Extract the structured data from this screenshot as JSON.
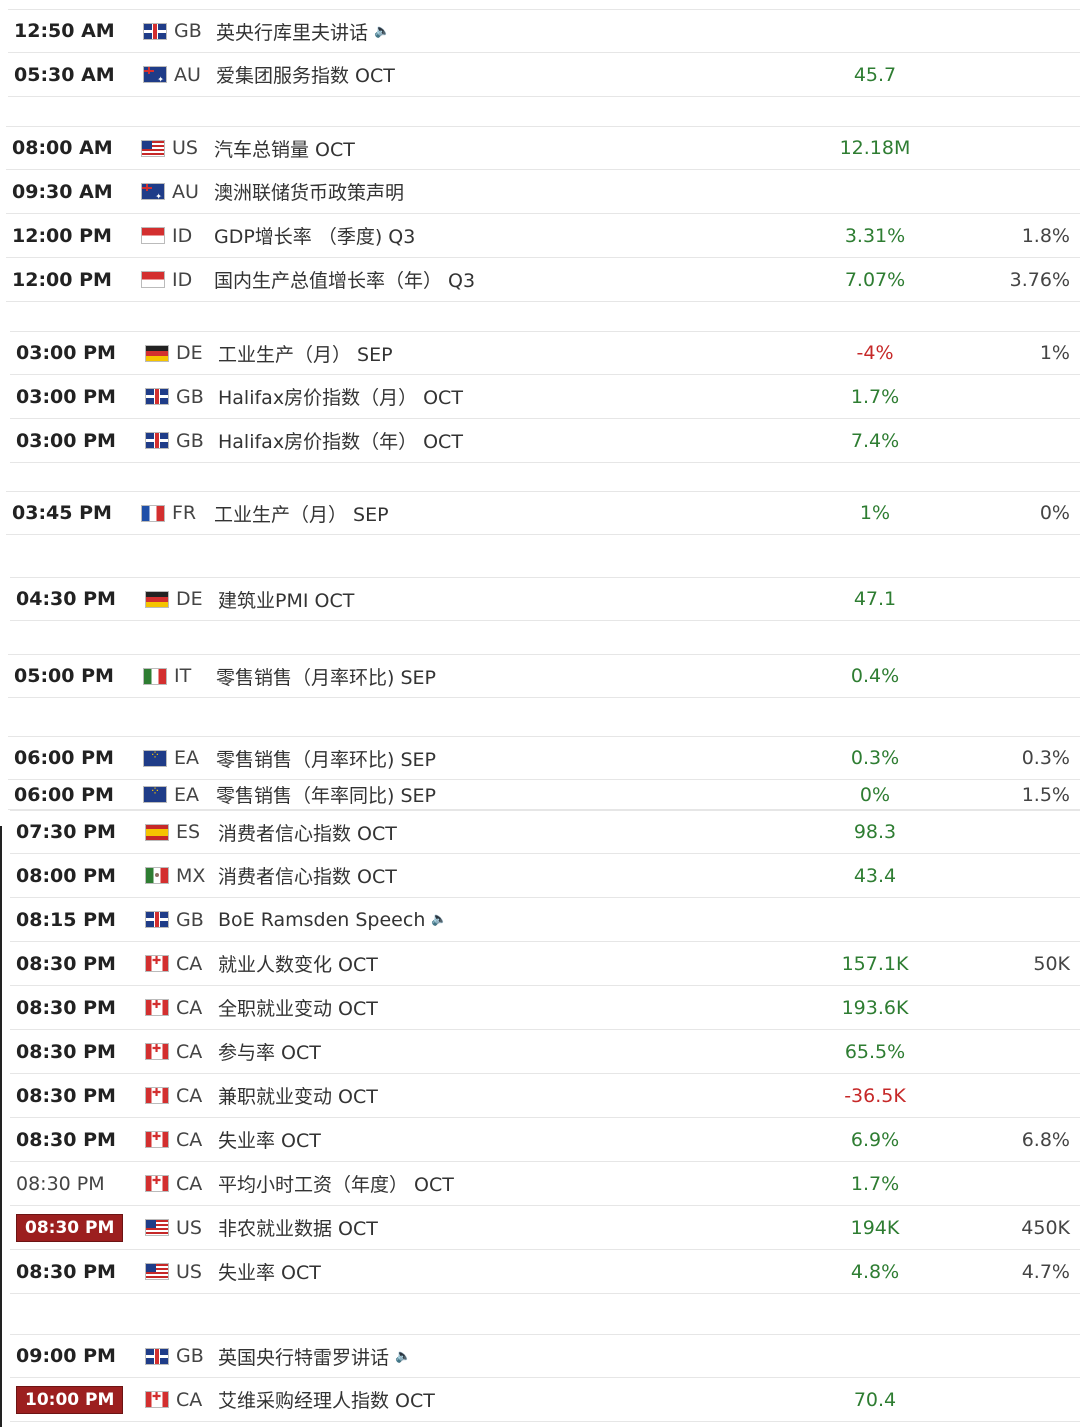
{
  "speaker_icon": "speaker-icon",
  "rows": [
    {
      "time": "12:50 AM",
      "country": "GB",
      "flag": "gb",
      "event": "英央行库里夫讲话",
      "speaker": true,
      "actual": "",
      "forecast": ""
    },
    {
      "time": "05:30 AM",
      "country": "AU",
      "flag": "au",
      "event": "爱集团服务指数 OCT",
      "actual": "45.7",
      "forecast": ""
    },
    {
      "time": "08:00 AM",
      "country": "US",
      "flag": "us",
      "event": "汽车总销量 OCT",
      "actual": "12.18M",
      "forecast": ""
    },
    {
      "time": "09:30 AM",
      "country": "AU",
      "flag": "au",
      "event": "澳洲联储货币政策声明",
      "actual": "",
      "forecast": ""
    },
    {
      "time": "12:00 PM",
      "country": "ID",
      "flag": "id",
      "event": "GDP增长率 （季度) Q3",
      "actual": "3.31%",
      "forecast": "1.8%"
    },
    {
      "time": "12:00 PM",
      "country": "ID",
      "flag": "id",
      "event": "国内生产总值增长率（年） Q3",
      "actual": "7.07%",
      "forecast": "3.76%"
    },
    {
      "time": "03:00 PM",
      "country": "DE",
      "flag": "de",
      "event": "工业生产（月） SEP",
      "actual": "-4%",
      "forecast": "1%",
      "neg": true
    },
    {
      "time": "03:00 PM",
      "country": "GB",
      "flag": "gb",
      "event": "Halifax房价指数（月） OCT",
      "actual": "1.7%",
      "forecast": ""
    },
    {
      "time": "03:00 PM",
      "country": "GB",
      "flag": "gb",
      "event": "Halifax房价指数（年） OCT",
      "actual": "7.4%",
      "forecast": ""
    },
    {
      "time": "03:45 PM",
      "country": "FR",
      "flag": "fr",
      "event": "工业生产（月） SEP",
      "actual": "1%",
      "forecast": "0%"
    },
    {
      "time": "04:30 PM",
      "country": "DE",
      "flag": "de",
      "event": "建筑业PMI OCT",
      "actual": "47.1",
      "forecast": ""
    },
    {
      "time": "05:00 PM",
      "country": "IT",
      "flag": "it",
      "event": "零售销售（月率环比) SEP",
      "actual": "0.4%",
      "forecast": ""
    },
    {
      "time": "06:00 PM",
      "country": "EA",
      "flag": "ea",
      "event": "零售销售（月率环比) SEP",
      "actual": "0.3%",
      "forecast": "0.3%"
    },
    {
      "time": "06:00 PM",
      "country": "EA",
      "flag": "ea",
      "event": "零售销售（年率同比) SEP",
      "actual": "0%",
      "forecast": "1.5%"
    },
    {
      "time": "07:30 PM",
      "country": "ES",
      "flag": "es",
      "event": "消费者信心指数 OCT",
      "actual": "98.3",
      "forecast": ""
    },
    {
      "time": "08:00 PM",
      "country": "MX",
      "flag": "mx",
      "event": "消费者信心指数 OCT",
      "actual": "43.4",
      "forecast": ""
    },
    {
      "time": "08:15 PM",
      "country": "GB",
      "flag": "gb",
      "event": "BoE Ramsden Speech",
      "speaker": true,
      "actual": "",
      "forecast": ""
    },
    {
      "time": "08:30 PM",
      "country": "CA",
      "flag": "ca",
      "event": "就业人数变化 OCT",
      "actual": "157.1K",
      "forecast": "50K"
    },
    {
      "time": "08:30 PM",
      "country": "CA",
      "flag": "ca",
      "event": "全职就业变动 OCT",
      "actual": "193.6K",
      "forecast": ""
    },
    {
      "time": "08:30 PM",
      "country": "CA",
      "flag": "ca",
      "event": "参与率 OCT",
      "actual": "65.5%",
      "forecast": ""
    },
    {
      "time": "08:30 PM",
      "country": "CA",
      "flag": "ca",
      "event": "兼职就业变动 OCT",
      "actual": "-36.5K",
      "forecast": "",
      "neg": true
    },
    {
      "time": "08:30 PM",
      "country": "CA",
      "flag": "ca",
      "event": "失业率 OCT",
      "actual": "6.9%",
      "forecast": "6.8%"
    },
    {
      "time": "08:30 PM",
      "country": "CA",
      "flag": "ca",
      "event": "平均小时工资（年度） OCT",
      "actual": "1.7%",
      "forecast": "",
      "normal_time": true
    },
    {
      "time": "08:30 PM",
      "country": "US",
      "flag": "us",
      "event": "非农就业数据 OCT",
      "actual": "194K",
      "forecast": "450K",
      "highlight": true
    },
    {
      "time": "08:30 PM",
      "country": "US",
      "flag": "us",
      "event": "失业率 OCT",
      "actual": "4.8%",
      "forecast": "4.7%"
    },
    {
      "time": "09:00 PM",
      "country": "GB",
      "flag": "gb",
      "event": "英国央行特雷罗讲话",
      "speaker": true,
      "actual": "",
      "forecast": ""
    },
    {
      "time": "10:00 PM",
      "country": "CA",
      "flag": "ca",
      "event": "艾维采购经理人指数 OCT",
      "actual": "70.4",
      "forecast": "",
      "highlight": true
    }
  ]
}
